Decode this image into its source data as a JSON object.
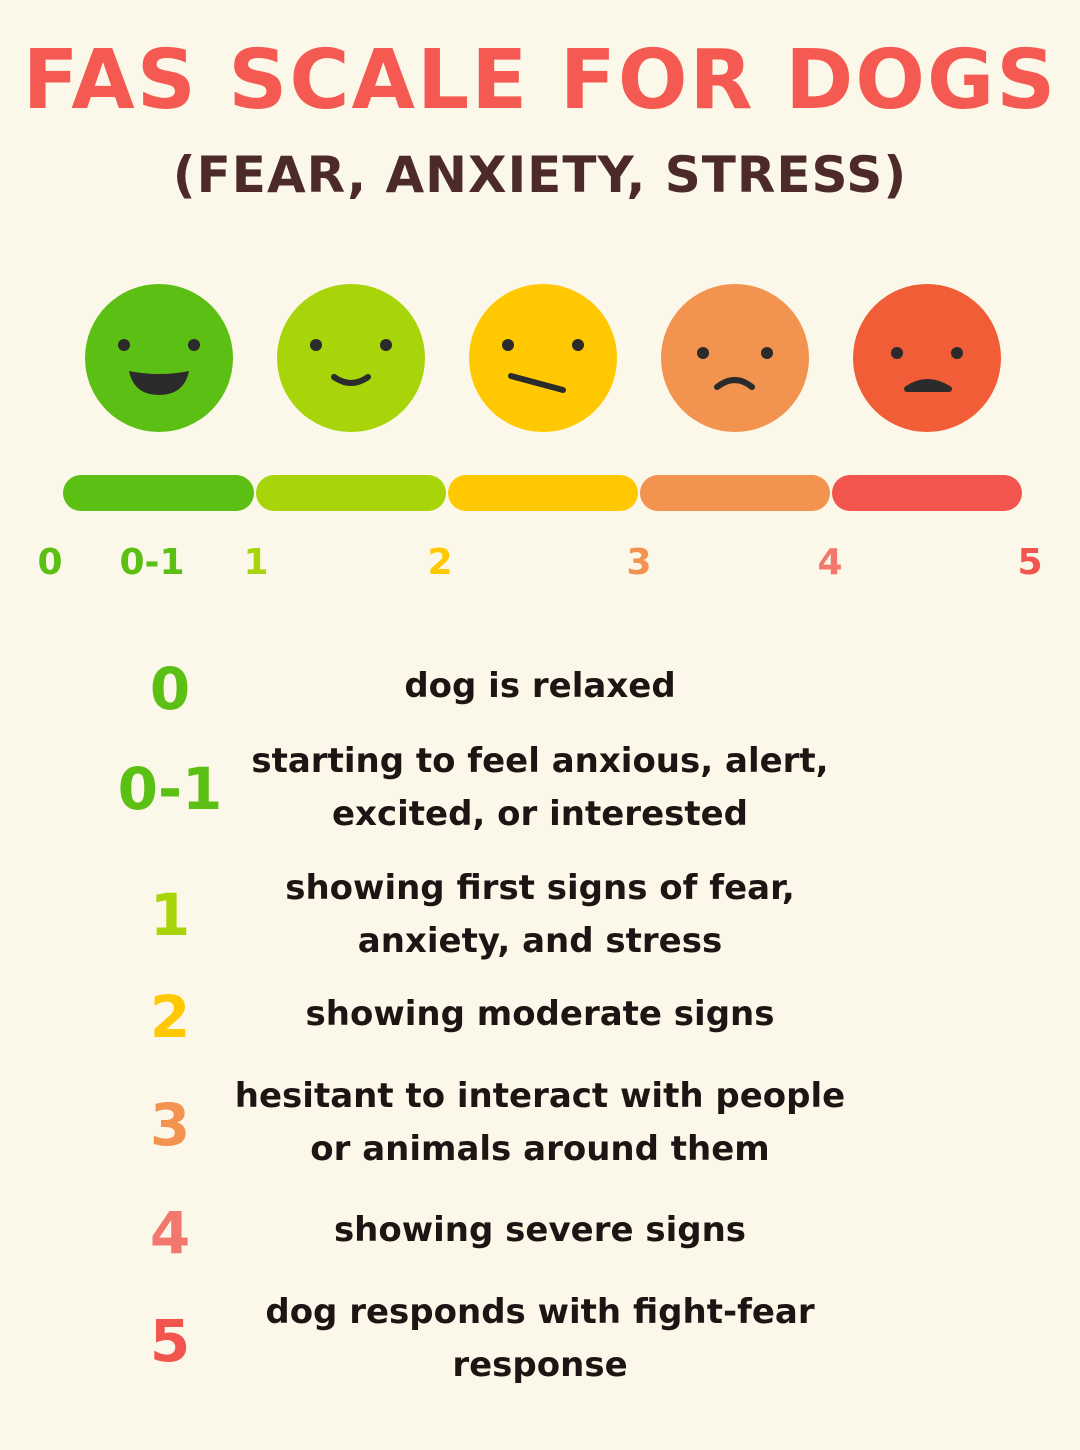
{
  "title": "FAS SCALE FOR DOGS",
  "subtitle": "(FEAR, ANXIETY, STRESS)",
  "colors": {
    "background": "#fbf8e9",
    "title": "#f55a52",
    "subtitle": "#4d2a2a",
    "level_0": "#5cbf13",
    "level_1": "#a8d40a",
    "level_2": "#ffc800",
    "level_3": "#f39350",
    "level_4": "#f2776c",
    "level_5": "#f2554d"
  },
  "faces": [
    {
      "icon": "big-smile-face-icon",
      "color": "#5cbf13"
    },
    {
      "icon": "smile-face-icon",
      "color": "#a8d40a"
    },
    {
      "icon": "unsure-face-icon",
      "color": "#ffc800"
    },
    {
      "icon": "frown-face-icon",
      "color": "#f39350"
    },
    {
      "icon": "sad-face-icon",
      "color": "#f05d36"
    }
  ],
  "scale_ticks": [
    {
      "label": "0",
      "color": "#5cbf13"
    },
    {
      "label": "0-1",
      "color": "#5cbf13"
    },
    {
      "label": "1",
      "color": "#a8d40a"
    },
    {
      "label": "2",
      "color": "#ffc800"
    },
    {
      "label": "3",
      "color": "#f39350"
    },
    {
      "label": "4",
      "color": "#f2776c"
    },
    {
      "label": "5",
      "color": "#f2554d"
    }
  ],
  "levels": [
    {
      "level": "0",
      "description": "dog is relaxed",
      "color": "#5cbf13"
    },
    {
      "level": "0-1",
      "description": "starting to feel anxious, alert, excited, or interested",
      "color": "#5cbf13"
    },
    {
      "level": "1",
      "description": "showing first signs of fear, anxiety, and stress",
      "color": "#a8d40a"
    },
    {
      "level": "2",
      "description": "showing moderate signs",
      "color": "#ffc800"
    },
    {
      "level": "3",
      "description": "hesitant to interact with people or animals around them",
      "color": "#f39350"
    },
    {
      "level": "4",
      "description": "showing severe signs",
      "color": "#f2776c"
    },
    {
      "level": "5",
      "description": "dog responds with fight-fear response",
      "color": "#f2554d"
    }
  ]
}
